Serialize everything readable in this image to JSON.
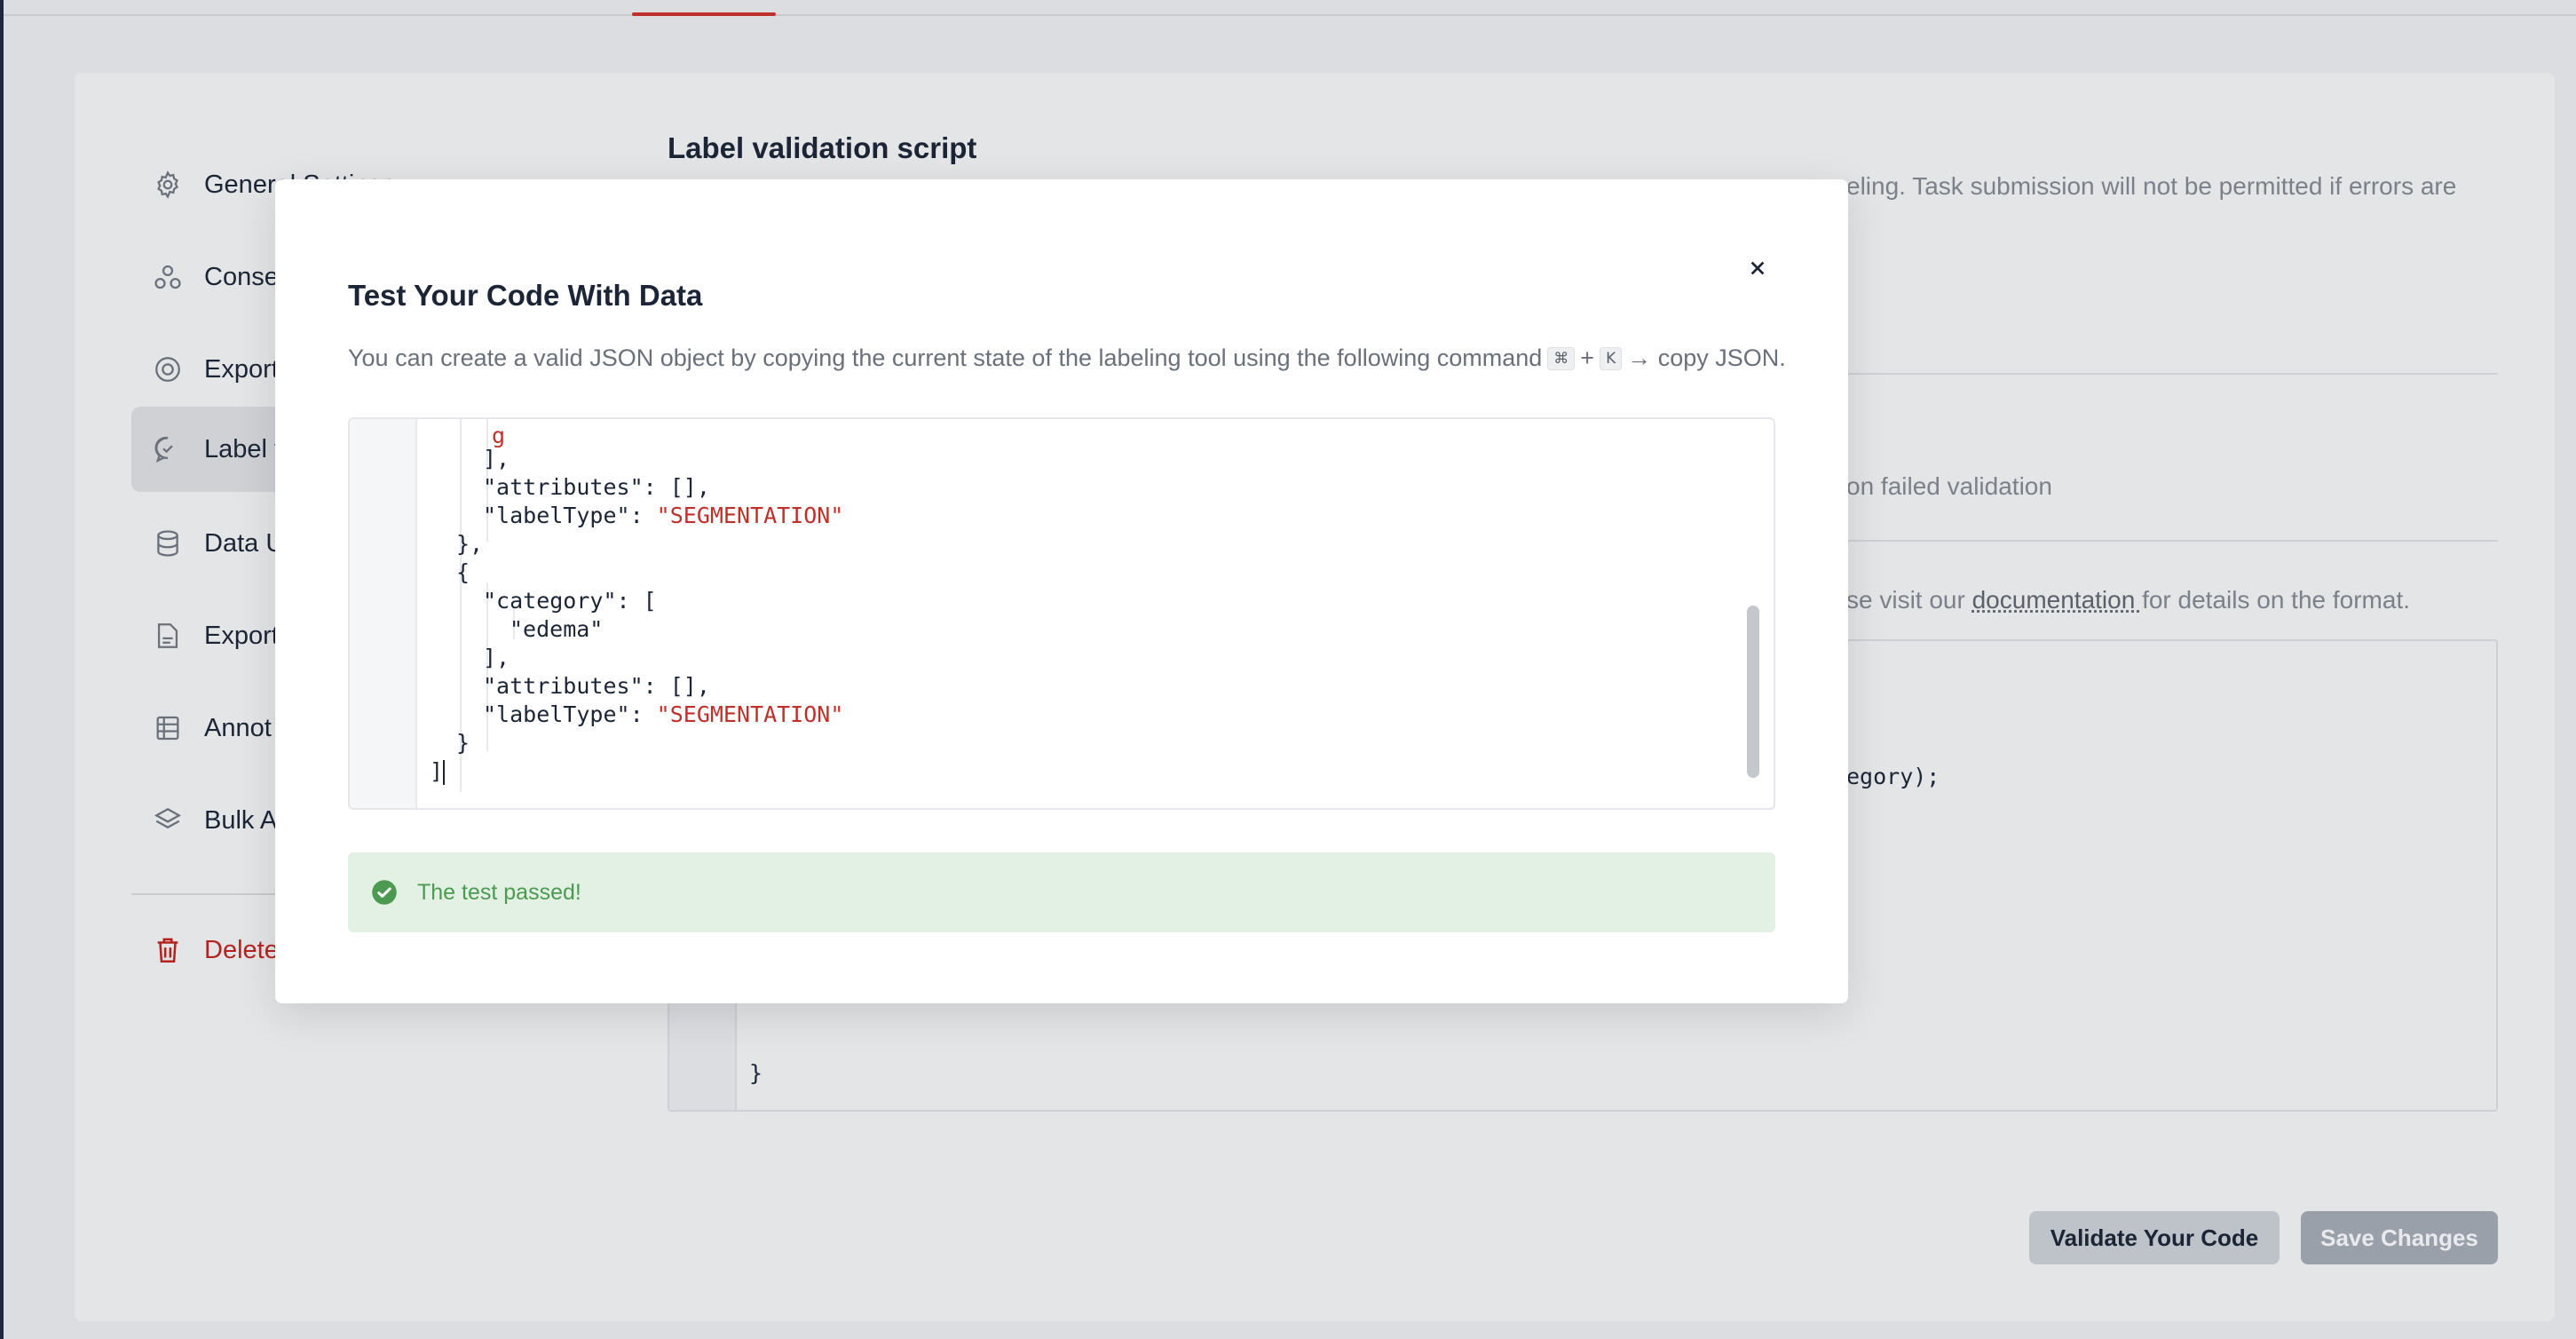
{
  "nav": {
    "items": [
      {
        "label": "General Settings",
        "icon": "gear-icon"
      },
      {
        "label": "Conse",
        "icon": "users-icon"
      },
      {
        "label": "Export",
        "icon": "target-icon"
      },
      {
        "label": "Label v",
        "icon": "chat-check-icon",
        "active": true
      },
      {
        "label": "Data U",
        "icon": "database-icon"
      },
      {
        "label": "Export",
        "icon": "file-icon"
      },
      {
        "label": "Annot",
        "icon": "table-icon"
      },
      {
        "label": "Bulk A",
        "icon": "layers-icon"
      }
    ],
    "delete": {
      "label": "Delete",
      "icon": "trash-icon"
    }
  },
  "section": {
    "title": "Label validation script",
    "desc_partial": "eling. Task submission will not be permitted if errors are",
    "failed_partial": "on failed validation",
    "docs_prefix": "se visit our ",
    "docs_link": "documentation ",
    "docs_suffix": "for details on the format.",
    "bg_code_1": "egory);",
    "bg_code_2": "}"
  },
  "buttons": {
    "validate": "Validate Your Code",
    "save": "Save Changes"
  },
  "modal": {
    "title": "Test Your Code With Data",
    "desc_before": "You can create a valid JSON object by copying the current state of the labeling tool using the following command",
    "kbd_cmd": "⌘",
    "plus": "+",
    "kbd_key": "K",
    "desc_after": "→ copy JSON.",
    "code": {
      "l1": "],",
      "l2": "\"attributes\": [],",
      "l3_key": "\"labelType\": ",
      "l3_val": "\"SEGMENTATION\"",
      "l4": "},",
      "l5": "{",
      "l6": "\"category\": [",
      "l7": "\"edema\"",
      "l8": "],",
      "l9": "\"attributes\": [],",
      "l10_key": "\"labelType\": ",
      "l10_val": "\"SEGMENTATION\"",
      "l11": "}",
      "l12": "]"
    },
    "alert": "The test passed!"
  },
  "colors": {
    "accent": "#c0302b",
    "success_text": "#4c9a52",
    "success_bg": "#e2f1e3"
  }
}
